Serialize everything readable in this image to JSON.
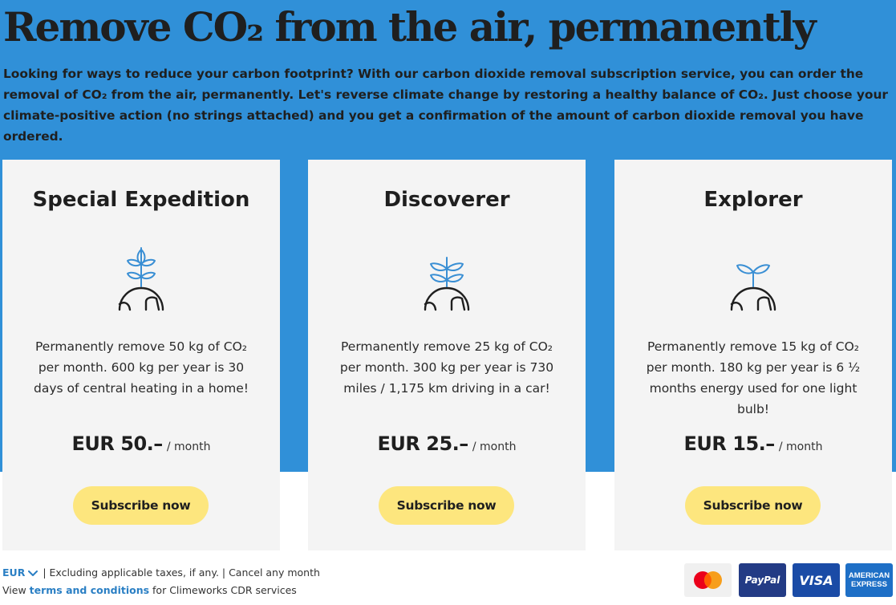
{
  "hero": {
    "title": "Remove CO₂ from the air, permanently",
    "intro": "Looking for ways to reduce your carbon footprint? With our carbon dioxide removal subscription service, you can order the removal of CO₂ from the air, permanently. Let's reverse climate change by restoring a healthy balance of CO₂. Just choose your climate-positive action (no strings attached) and you get a confirmation of the amount of carbon dioxide removal you have ordered."
  },
  "plans": [
    {
      "name": "Special Expedition",
      "icon": "plant-globe-large-icon",
      "description": "Permanently remove 50 kg of CO₂ per month. 600 kg per year is 30 days of central heating in a home!",
      "price": "EUR 50.–",
      "unit": "/ month",
      "cta": "Subscribe now"
    },
    {
      "name": "Discoverer",
      "icon": "plant-globe-medium-icon",
      "description": "Permanently remove 25 kg of CO₂ per month. 300 kg per year is 730 miles / 1,175 km driving in a car!",
      "price": "EUR 25.–",
      "unit": "/ month",
      "cta": "Subscribe now"
    },
    {
      "name": "Explorer",
      "icon": "plant-globe-small-icon",
      "description": "Permanently remove 15 kg of CO₂ per month. 180 kg per year is 6 ½ months energy used for one light bulb!",
      "price": "EUR 15.–",
      "unit": "/ month",
      "cta": "Subscribe now"
    }
  ],
  "footer": {
    "currency": "EUR",
    "notice": "| Excluding applicable taxes, if any. | Cancel any month",
    "terms_prefix": "View",
    "terms_link": "terms and conditions",
    "terms_suffix": "for Climeworks CDR services"
  },
  "payments": {
    "paypal": "PayPal",
    "visa": "VISA",
    "amex_line1": "AMERICAN",
    "amex_line2": "EXPRESS"
  },
  "colors": {
    "hero_bg": "#3090d8",
    "card_bg": "#f4f4f4",
    "button_bg": "#fde67e",
    "link": "#2a7fc4",
    "icon_accent": "#3a8fd4"
  }
}
